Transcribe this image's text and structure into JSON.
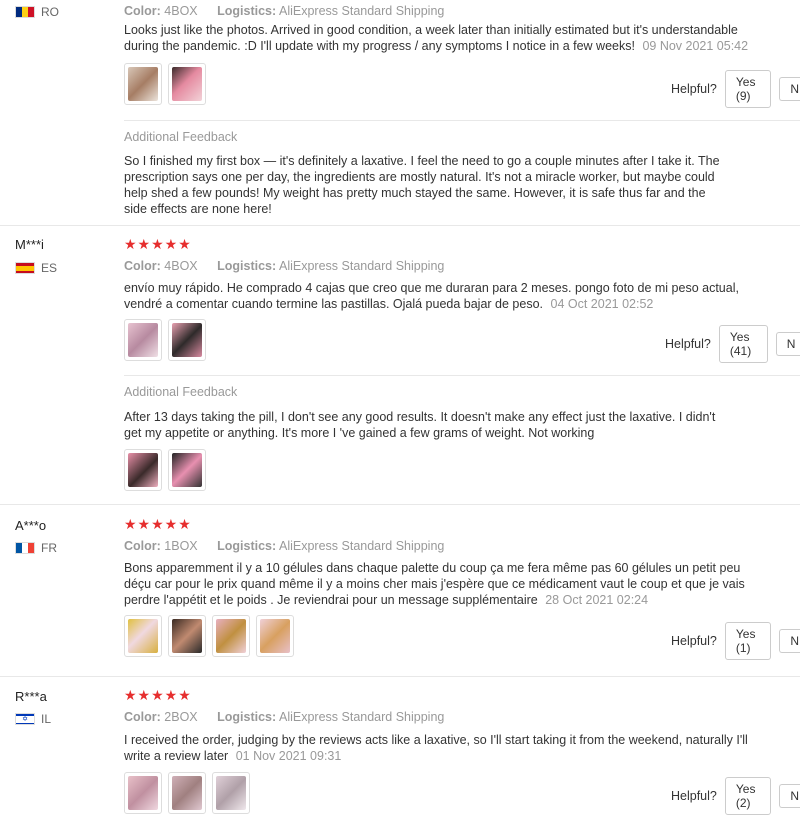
{
  "reviews": [
    {
      "user": "",
      "country": "RO",
      "color_label": "Color:",
      "color": "4BOX",
      "logistics_label": "Logistics:",
      "logistics": "AliExpress Standard Shipping",
      "text": "Looks just like the photos. Arrived in good condition, a week later than initially estimated but it's understandable during the pandemic. :D I'll update with my progress / any symptoms I notice in a few weeks!",
      "date": "09 Nov 2021 05:42",
      "helpful_label": "Helpful?",
      "yes": "Yes (9)",
      "no": "N",
      "additional_title": "Additional Feedback",
      "additional_text": "So I finished my first box — it's definitely a laxative. I feel the need to go a couple minutes after I take it. The prescription says one per day, the ingredients are mostly natural. It's not a miracle worker, but maybe could help shed a few pounds! My weight has pretty much stayed the same. However, it is safe thus far and the side effects are none here!"
    },
    {
      "user": "M***i",
      "country": "ES",
      "stars": "★★★★★",
      "color_label": "Color:",
      "color": "4BOX",
      "logistics_label": "Logistics:",
      "logistics": "AliExpress Standard Shipping",
      "text": "envío muy rápido. He comprado 4 cajas que creo que me duraran para 2 meses. pongo foto de mi peso actual, vendré a comentar cuando termine las pastillas. Ojalá pueda bajar de peso.",
      "date": "04 Oct 2021 02:52",
      "helpful_label": "Helpful?",
      "yes": "Yes (41)",
      "no": "N",
      "additional_title": "Additional Feedback",
      "additional_text": "After 13 days taking the pill, I don't see any good results. It doesn't make any effect just the laxative. I didn't get my appetite or anything. It's more I 've gained a few grams of weight. Not working"
    },
    {
      "user": "A***o",
      "country": "FR",
      "stars": "★★★★★",
      "color_label": "Color:",
      "color": "1BOX",
      "logistics_label": "Logistics:",
      "logistics": "AliExpress Standard Shipping",
      "text": "Bons apparemment il y a 10 gélules dans chaque palette du coup ça me fera même pas 60 gélules un petit peu déçu car pour le prix quand même il y a moins cher mais j'espère que ce médicament vaut le coup et que je vais perdre l'appétit et le poids . Je reviendrai pour un message supplémentaire",
      "date": "28 Oct 2021 02:24",
      "helpful_label": "Helpful?",
      "yes": "Yes (1)",
      "no": "N"
    },
    {
      "user": "R***a",
      "country": "IL",
      "stars": "★★★★★",
      "color_label": "Color:",
      "color": "2BOX",
      "logistics_label": "Logistics:",
      "logistics": "AliExpress Standard Shipping",
      "text": "I received the order, judging by the reviews acts like a laxative, so I'll start taking it from the weekend, naturally I'll write a review later",
      "date": "01 Nov 2021 09:31",
      "helpful_label": "Helpful?",
      "yes": "Yes (2)",
      "no": "N"
    }
  ],
  "colors": {
    "star": "#e62e2e",
    "muted": "#999999",
    "text": "#333333"
  }
}
